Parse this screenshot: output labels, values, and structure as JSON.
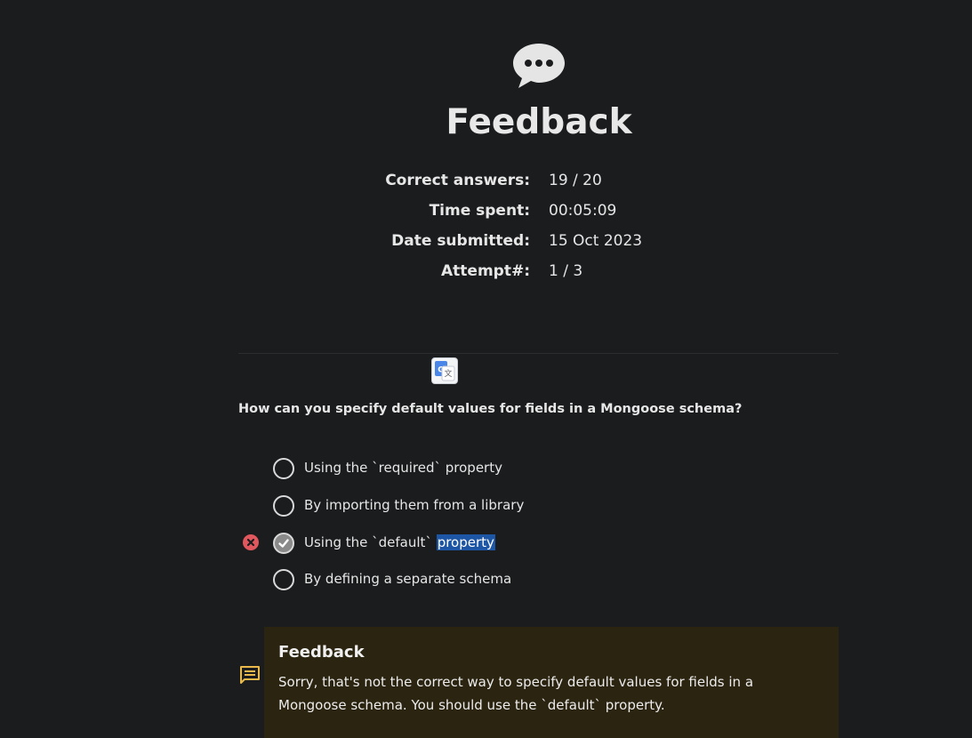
{
  "header": {
    "icon": "speech-bubble-icon",
    "title": "Feedback"
  },
  "stats": [
    {
      "label": "Correct answers:",
      "value": "19 / 20"
    },
    {
      "label": "Time spent:",
      "value": "00:05:09"
    },
    {
      "label": "Date submitted:",
      "value": "15 Oct 2023"
    },
    {
      "label": "Attempt#:",
      "value": "1 / 3"
    }
  ],
  "translate": {
    "icon": "google-translate-icon"
  },
  "question": {
    "text": "How can you specify default values for fields in a Mongoose schema?",
    "options": [
      {
        "text": "Using the `required` property",
        "selected": false
      },
      {
        "text": "By importing them from a library",
        "selected": false
      },
      {
        "text_before": "Using the `default` ",
        "text_highlight": "property",
        "selected": true,
        "status": "incorrect"
      },
      {
        "text": "By defining a separate schema",
        "selected": false
      }
    ]
  },
  "feedback": {
    "icon": "comment-icon",
    "title": "Feedback",
    "text": "Sorry, that's not the correct way to specify default values for fields in a Mongoose schema. You should use the `default` property."
  },
  "colors": {
    "background": "#1b1c1e",
    "incorrect": "#e0585d",
    "feedback_bg": "#2b2410",
    "feedback_icon": "#e8b84a",
    "selection": "#1e56a6"
  }
}
